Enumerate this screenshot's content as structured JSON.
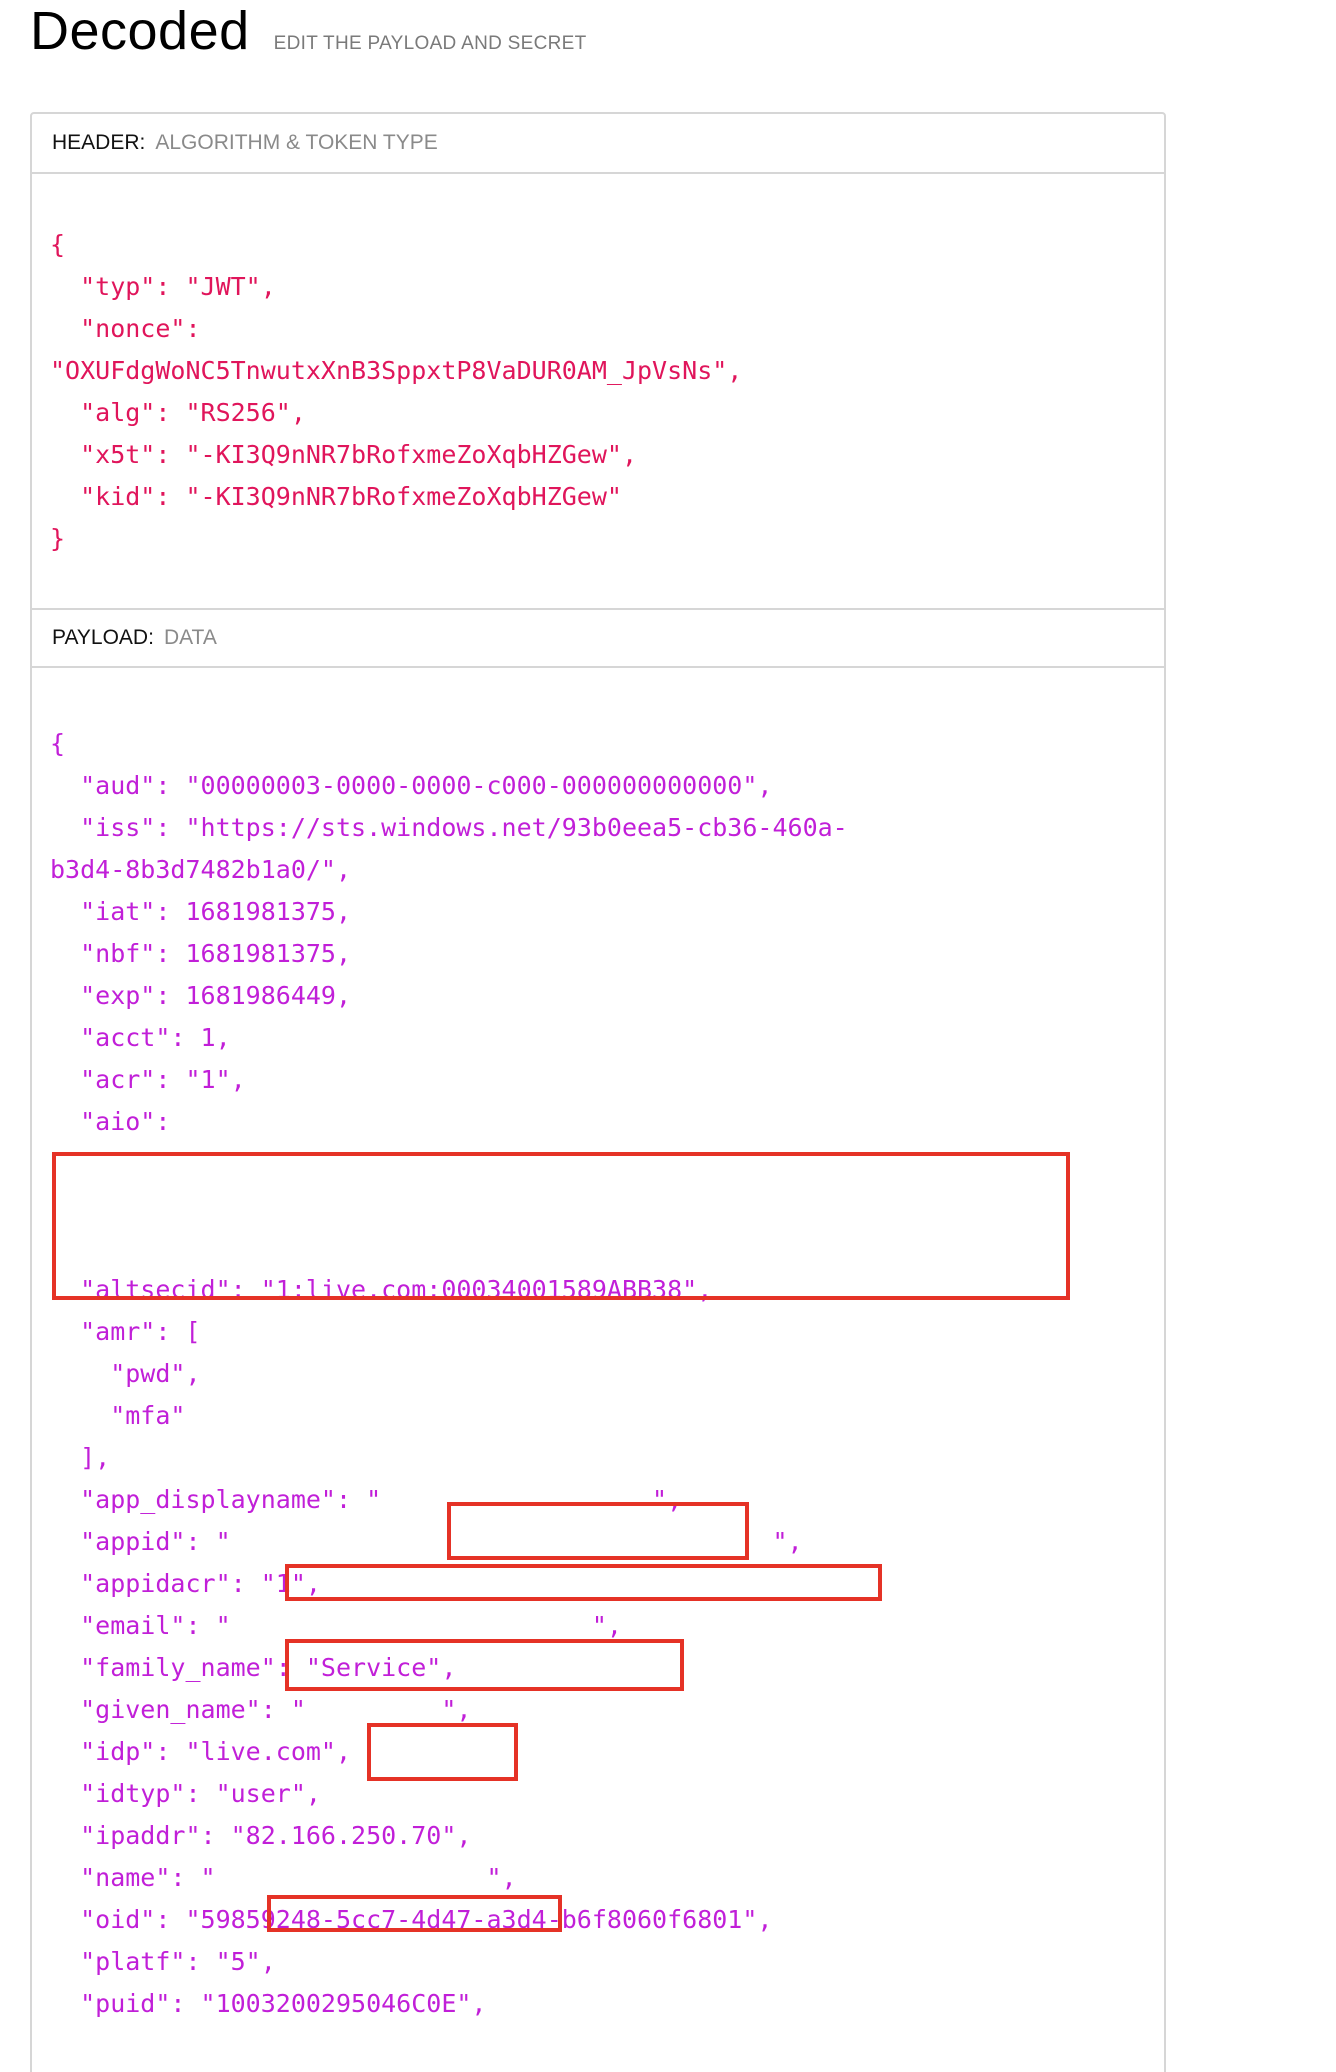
{
  "page": {
    "title": "Decoded",
    "subtitle": "EDIT THE PAYLOAD AND SECRET"
  },
  "header_section": {
    "label": "HEADER:",
    "description": "ALGORITHM & TOKEN TYPE",
    "lines": [
      "{",
      "  \"typ\": \"JWT\",",
      "  \"nonce\":",
      "\"OXUFdgWoNC5TnwutxXnB3SppxtP8VaDUR0AM_JpVsNs\",",
      "  \"alg\": \"RS256\",",
      "  \"x5t\": \"-KI3Q9nNR7bRofxmeZoXqbHZGew\",",
      "  \"kid\": \"-KI3Q9nNR7bRofxmeZoXqbHZGew\"",
      "}"
    ]
  },
  "payload_section": {
    "label": "PAYLOAD:",
    "description": "DATA",
    "lines": [
      "{",
      "  \"aud\": \"00000003-0000-0000-c000-000000000000\",",
      "  \"iss\": \"https://sts.windows.net/93b0eea5-cb36-460a-",
      "b3d4-8b3d7482b1a0/\",",
      "  \"iat\": 1681981375,",
      "  \"nbf\": 1681981375,",
      "  \"exp\": 1681986449,",
      "  \"acct\": 1,",
      "  \"acr\": \"1\",",
      "  \"aio\":",
      "",
      "",
      "",
      "  \"altsecid\": \"1:live.com:00034001589ABB38\",",
      "  \"amr\": [",
      "    \"pwd\",",
      "    \"mfa\"",
      "  ],",
      "  \"app_displayname\": \"                  \",",
      "  \"appid\": \"                                    \",",
      "  \"appidacr\": \"1\",",
      "  \"email\": \"                        \",",
      "  \"family_name\": \"Service\",",
      "  \"given_name\": \"         \",",
      "  \"idp\": \"live.com\",",
      "  \"idtyp\": \"user\",",
      "  \"ipaddr\": \"82.166.250.70\",",
      "  \"name\": \"                  \",",
      "  \"oid\": \"59859248-5cc7-4d47-a3d4-b6f8060f6801\",",
      "  \"platf\": \"5\",",
      "  \"puid\": \"1003200295046C0E\","
    ]
  },
  "colors": {
    "header_json": "#e0155b",
    "payload_json": "#c11fd8",
    "redaction_box": "#e53226",
    "panel_border": "#d6d6d6"
  }
}
